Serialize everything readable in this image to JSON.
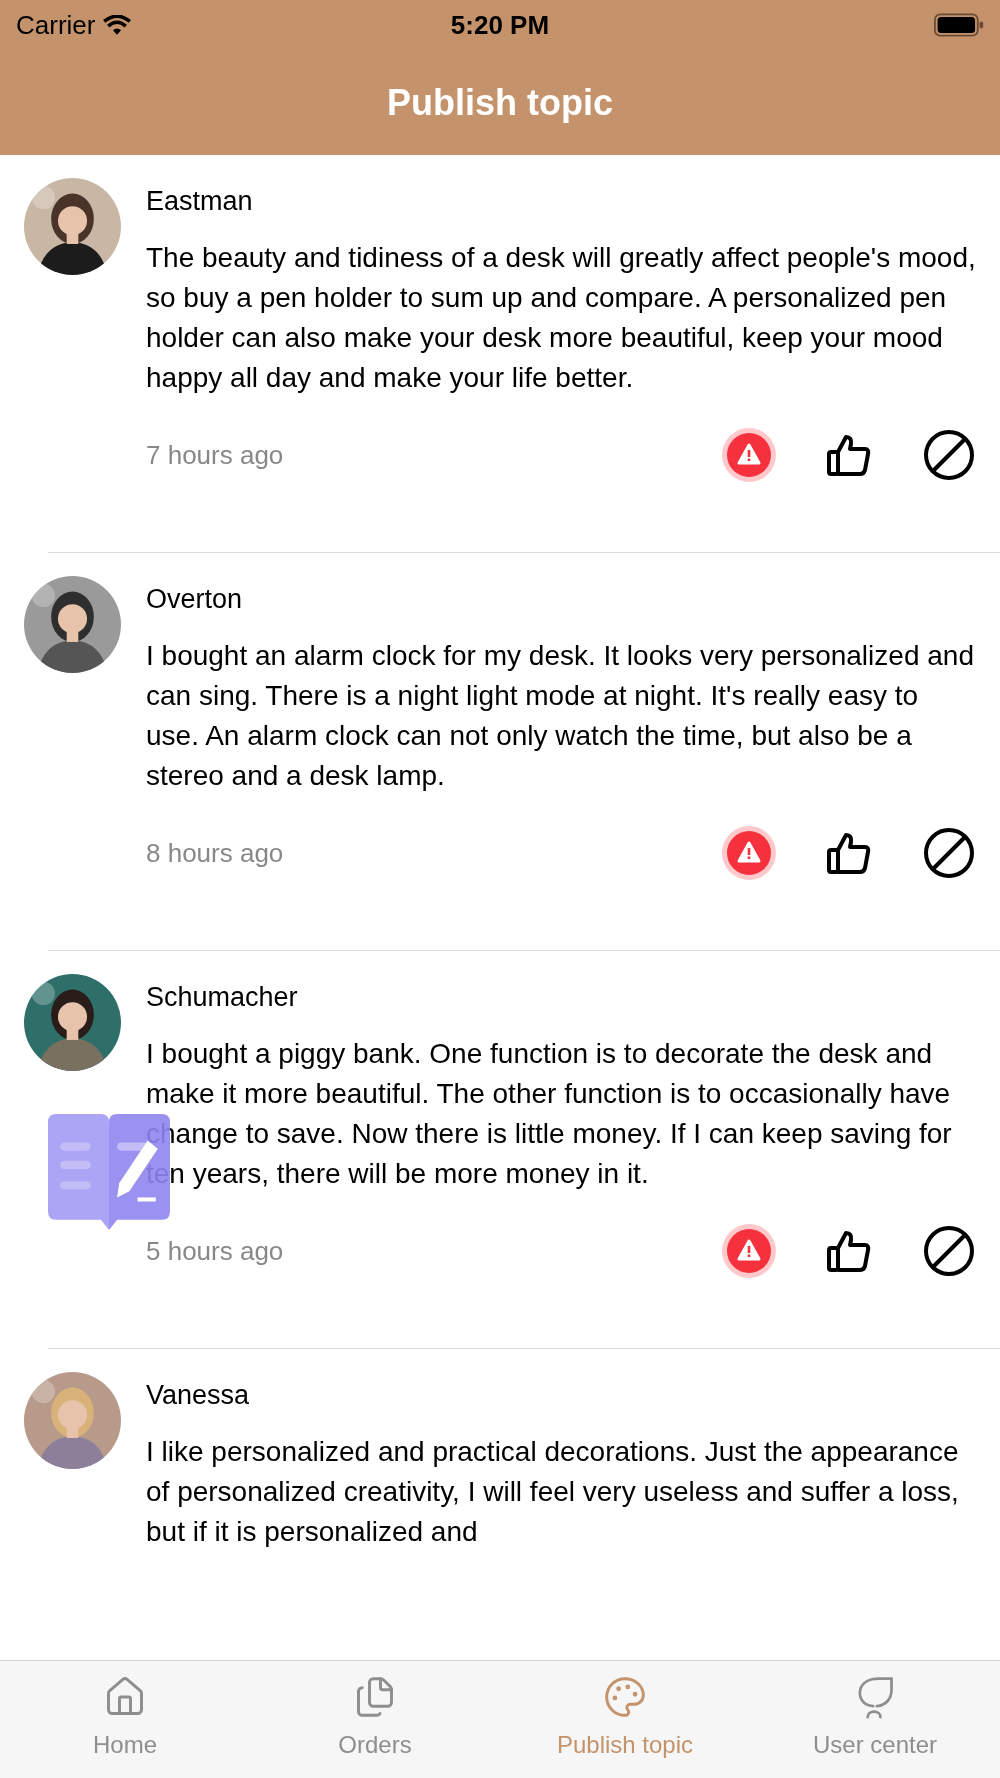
{
  "status_bar": {
    "carrier": "Carrier",
    "time": "5:20 PM"
  },
  "nav_bar": {
    "title": "Publish topic"
  },
  "posts": [
    {
      "author": "Eastman",
      "text": "The beauty and tidiness of a desk will greatly affect people's mood, so buy a pen holder to sum up and compare. A personalized pen holder can also make your desk more beautiful, keep your mood happy all day and make your life better.",
      "time": "7 hours ago"
    },
    {
      "author": "Overton",
      "text": "I bought an alarm clock for my desk. It looks very personalized and can sing. There is a night light mode at night. It's really easy to use. An alarm clock can not only watch the time, but also be a stereo and a desk lamp.",
      "time": "8 hours ago"
    },
    {
      "author": "Schumacher",
      "text": "I bought a piggy bank. One function is to decorate the desk and make it more beautiful. The other function is to occasionally have change to save. Now there is little money. If I can keep saving for ten years, there will be more money in it.",
      "time": "5 hours ago"
    },
    {
      "author": "Vanessa",
      "text": "I like personalized and practical decorations. Just the appearance of personalized creativity, I will feel very useless and suffer a loss, but if it is personalized and"
    }
  ],
  "tab_bar": [
    {
      "label": "Home",
      "selected": false
    },
    {
      "label": "Orders",
      "selected": false
    },
    {
      "label": "Publish topic",
      "selected": true
    },
    {
      "label": "User center",
      "selected": false
    }
  ]
}
